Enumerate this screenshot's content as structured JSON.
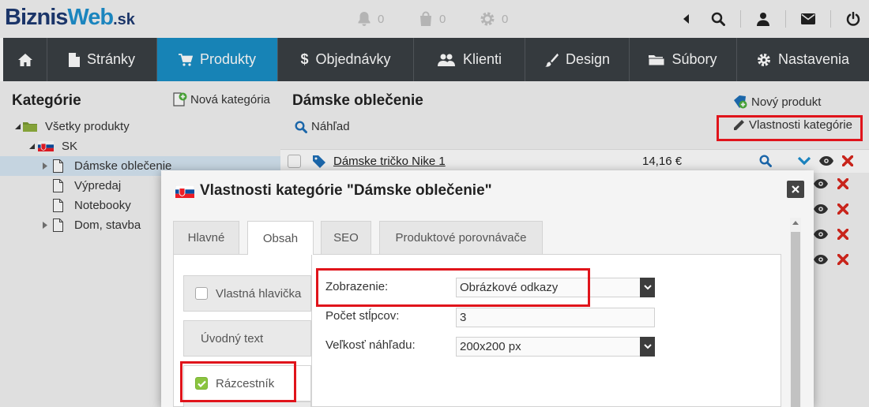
{
  "header": {
    "logo": {
      "part1": "Biznis",
      "part2": "Web",
      "suffix": ".sk"
    },
    "notifications": [
      {
        "icon": "bell-icon",
        "count": "0"
      },
      {
        "icon": "shopping-bag-icon",
        "count": "0"
      },
      {
        "icon": "cog-icon",
        "count": "0"
      }
    ],
    "icons": [
      "collapse-arrow-icon",
      "search-icon",
      "user-icon",
      "mail-icon",
      "power-icon"
    ]
  },
  "nav": {
    "items": [
      {
        "label": "",
        "icon": "home-icon"
      },
      {
        "label": "Stránky",
        "icon": "page-icon"
      },
      {
        "label": "Produkty",
        "icon": "cart-icon",
        "active": true
      },
      {
        "label": "Objednávky",
        "icon": "dollar-icon"
      },
      {
        "label": "Klienti",
        "icon": "users-icon"
      },
      {
        "label": "Design",
        "icon": "brush-icon"
      },
      {
        "label": "Súbory",
        "icon": "folder-icon"
      },
      {
        "label": "Nastavenia",
        "icon": "gear-icon"
      }
    ]
  },
  "categories": {
    "title": "Kategórie",
    "new_category": "Nová kategória",
    "tree": [
      {
        "label": "Všetky produkty",
        "icon": "folder-icon"
      },
      {
        "label": "SK",
        "icon": "flag-sk-icon"
      },
      {
        "label": "Dámske oblečenie",
        "icon": "page-icon",
        "selected": true
      },
      {
        "label": "Výpredaj",
        "icon": "page-icon"
      },
      {
        "label": "Notebooky",
        "icon": "page-icon"
      },
      {
        "label": "Dom, stavba",
        "icon": "page-icon"
      }
    ]
  },
  "main": {
    "title": "Dámske oblečenie",
    "preview": "Náhľad",
    "new_product": "Nový produkt",
    "category_properties": "Vlastnosti kategórie",
    "products": [
      {
        "name": "Dámske tričko Nike 1",
        "price": "14,16 €"
      }
    ]
  },
  "modal": {
    "title": "Vlastnosti kategórie \"Dámske oblečenie\"",
    "tabs": [
      "Hlavné",
      "Obsah",
      "SEO",
      "Produktové porovnávače"
    ],
    "active_tab": "Obsah",
    "side_items": [
      {
        "label": "Vlastná hlavička",
        "checkbox": true,
        "checked": false
      },
      {
        "label": "Úvodný text",
        "checkbox": false
      },
      {
        "label": "Rázcestník",
        "checkbox": true,
        "checked": true
      }
    ],
    "fields": [
      {
        "label": "Zobrazenie:",
        "value": "Obrázkové odkazy",
        "type": "select"
      },
      {
        "label": "Počet stĺpcov:",
        "value": "3",
        "type": "input"
      },
      {
        "label": "Veľkosť náhľadu:",
        "value": "200x200 px",
        "type": "select"
      }
    ]
  },
  "colors": {
    "nav_bg": "#3a3f44",
    "nav_active": "#1a8fc6",
    "highlight": "#e0141b",
    "checkbox_on": "#8bc43f",
    "link_blue": "#1e6fb8"
  }
}
